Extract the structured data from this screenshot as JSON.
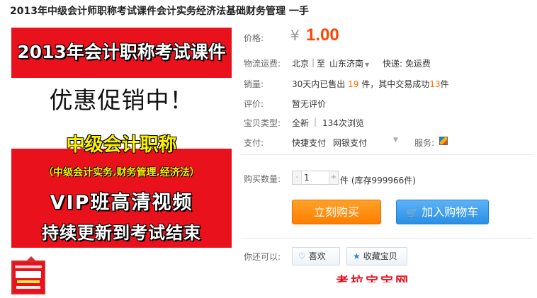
{
  "title": "2013年中级会计师职称考试课件会计实务经济法基础财务管理 一手",
  "product_image": {
    "banner": "2013年会计职称考试课件",
    "promo": "优惠促销中！",
    "line1": "中级会计职称",
    "line2": "（中级会计实务.财务管理.经济法）",
    "line3": "VIP班高清视频",
    "line4": "持续更新到考试结束"
  },
  "price": {
    "label": "价格:",
    "symbol": "¥",
    "value": "1.00"
  },
  "shipping": {
    "label": "物流运费:",
    "from": "北京",
    "sep": "至",
    "to": "山东济南",
    "fee": "快递: 免运费"
  },
  "sales": {
    "label": "销量:",
    "prefix": "30天内已售出",
    "sold": "19",
    "mid": "件，其中交易成功",
    "success": "13",
    "suffix": "件"
  },
  "rating": {
    "label": "评价:",
    "value": "暂无评价"
  },
  "type": {
    "label": "宝贝类型:",
    "condition": "全新",
    "divider": "|",
    "views": "134次浏览"
  },
  "payment": {
    "label": "支付:",
    "method1": "快捷支付",
    "method2": "网银支付",
    "service_label": "服务:"
  },
  "quantity": {
    "label": "购买数量:",
    "value": "1",
    "minus": "-",
    "plus": "+",
    "stock": "件 (库存999966件)"
  },
  "actions": {
    "buy": "立刻购买",
    "cart": "加入购物车"
  },
  "social": {
    "label": "你还可以:",
    "like": "喜欢",
    "favorite": "收藏宝贝"
  },
  "partial_text": "考拉宝宝网",
  "colors": {
    "price": "#ff4400",
    "buy": "#ff7e00",
    "cart": "#2a8fe6",
    "image_red": "#e8111c"
  }
}
